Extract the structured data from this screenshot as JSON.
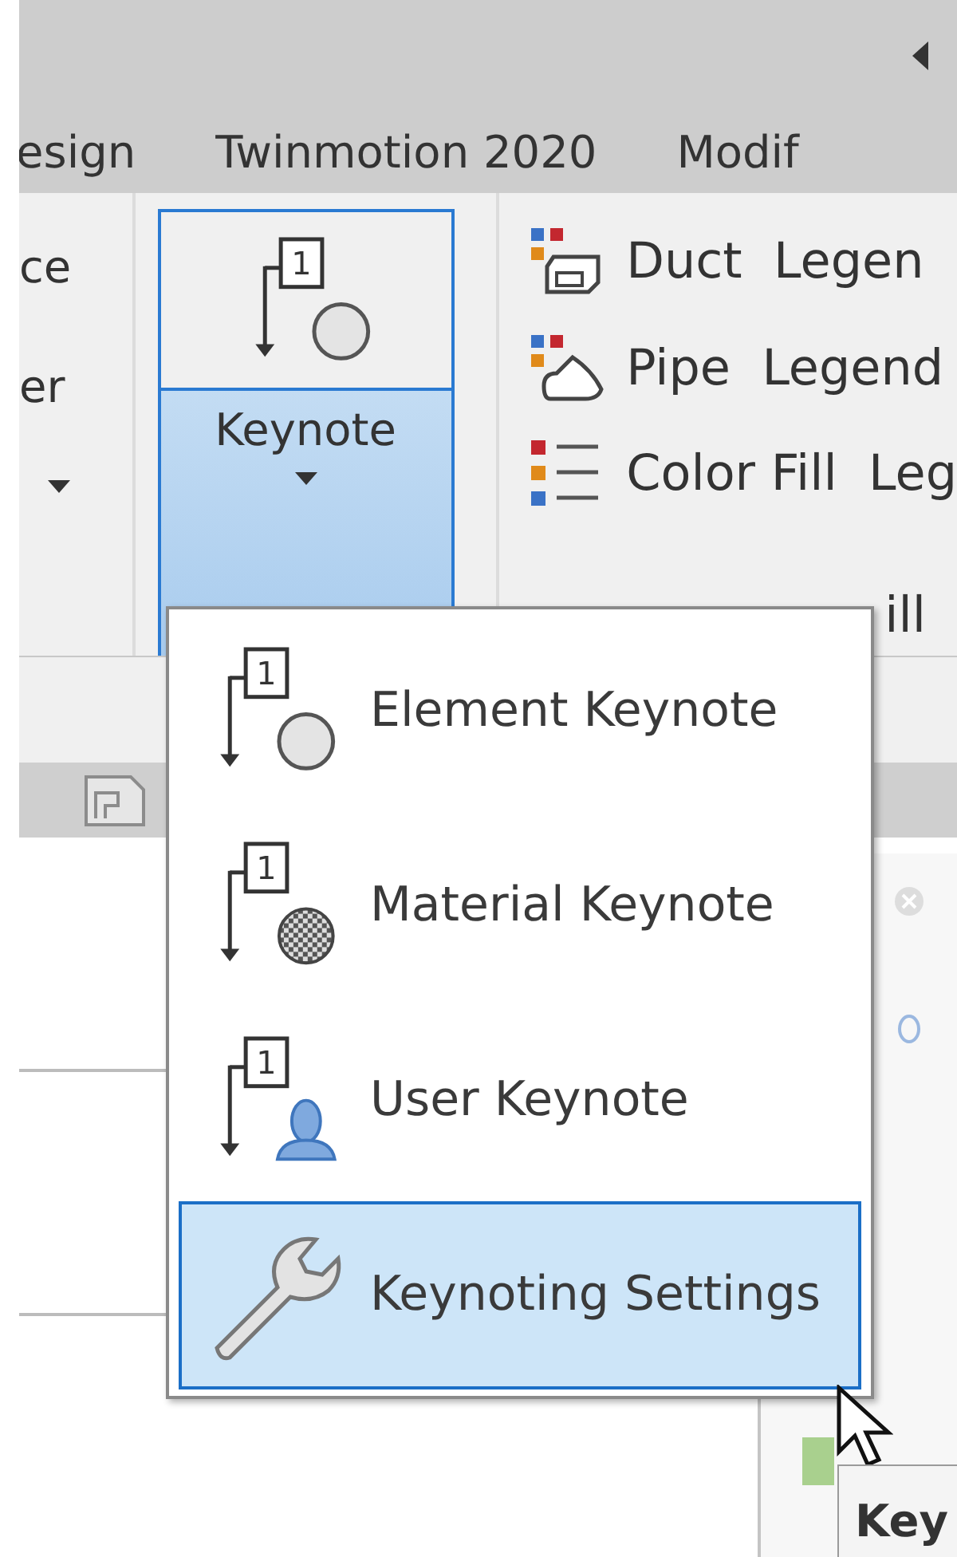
{
  "tabs": [
    {
      "label": "esign",
      "selected": false
    },
    {
      "label": "Twinmotion 2020",
      "selected": false
    },
    {
      "label": "Modif",
      "selected": false
    }
  ],
  "ribbon": {
    "left_items": [
      "ce",
      "er"
    ],
    "keynote_button": {
      "label": "Keynote",
      "tag_number": "1",
      "expanded": true
    },
    "legends": [
      {
        "label": "Duct  Legen",
        "kind": "duct"
      },
      {
        "label": "Pipe  Legend",
        "kind": "pipe"
      },
      {
        "label": "Color Fill  Leg",
        "kind": "color_fill"
      },
      {
        "label": "ill",
        "kind": "partial"
      }
    ]
  },
  "menu": {
    "items": [
      {
        "label": "Element Keynote",
        "kind": "element",
        "tag_number": "1",
        "selected": false
      },
      {
        "label": "Material Keynote",
        "kind": "material",
        "tag_number": "1",
        "selected": false
      },
      {
        "label": "User Keynote",
        "kind": "user",
        "tag_number": "1",
        "selected": false
      },
      {
        "label": "Keynoting Settings",
        "kind": "settings",
        "selected": true
      }
    ]
  },
  "tooltip": {
    "text": "Key"
  }
}
